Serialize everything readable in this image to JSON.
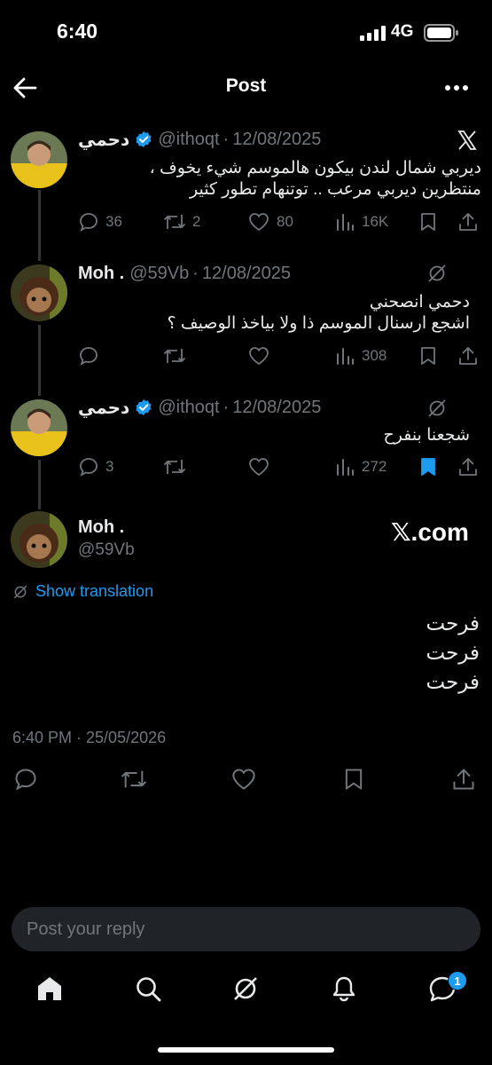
{
  "status_bar": {
    "time": "6:40",
    "network": "4G"
  },
  "header": {
    "title": "Post"
  },
  "posts": [
    {
      "display_name": "دحمي",
      "handle": "@ithoqt",
      "date": "12/08/2025",
      "text_lines": [
        "ديربي شمال لندن بيكون هالموسم شيء يخوف ،",
        "منتظرين ديربي مرعب .. توتنهام تطور كثير"
      ],
      "replies": "36",
      "reposts": "2",
      "likes": "80",
      "views": "16K"
    },
    {
      "display_name": "Moh .",
      "handle": "@59Vb",
      "date": "12/08/2025",
      "text_lines": [
        "دحمي انصحني",
        "اشجع ارسنال الموسم ذا ولا بياخذ الوصيف ؟"
      ],
      "views": "308"
    },
    {
      "display_name": "دحمي",
      "handle": "@ithoqt",
      "date": "12/08/2025",
      "text_lines": [
        "شجعنا بنفرح"
      ],
      "replies": "3",
      "views": "272"
    }
  ],
  "main_post": {
    "display_name": "Moh .",
    "handle": "@59Vb",
    "watermark": "𝕏.com",
    "translation_link": "Show translation",
    "text_lines": [
      "فرحت",
      "فرحت",
      "فرحت"
    ],
    "timestamp": "6:40 PM · 25/05/2026"
  },
  "reply_bar": {
    "placeholder": "Post your reply"
  },
  "bottom_nav": {
    "items": [
      "home-icon",
      "search-icon",
      "grok-icon",
      "notifications-icon",
      "messages-icon"
    ],
    "messages_badge": "1"
  },
  "colors": {
    "background": "#000000",
    "accent": "#1d9bf0",
    "muted": "#71767b",
    "text": "#e7e9ea"
  }
}
